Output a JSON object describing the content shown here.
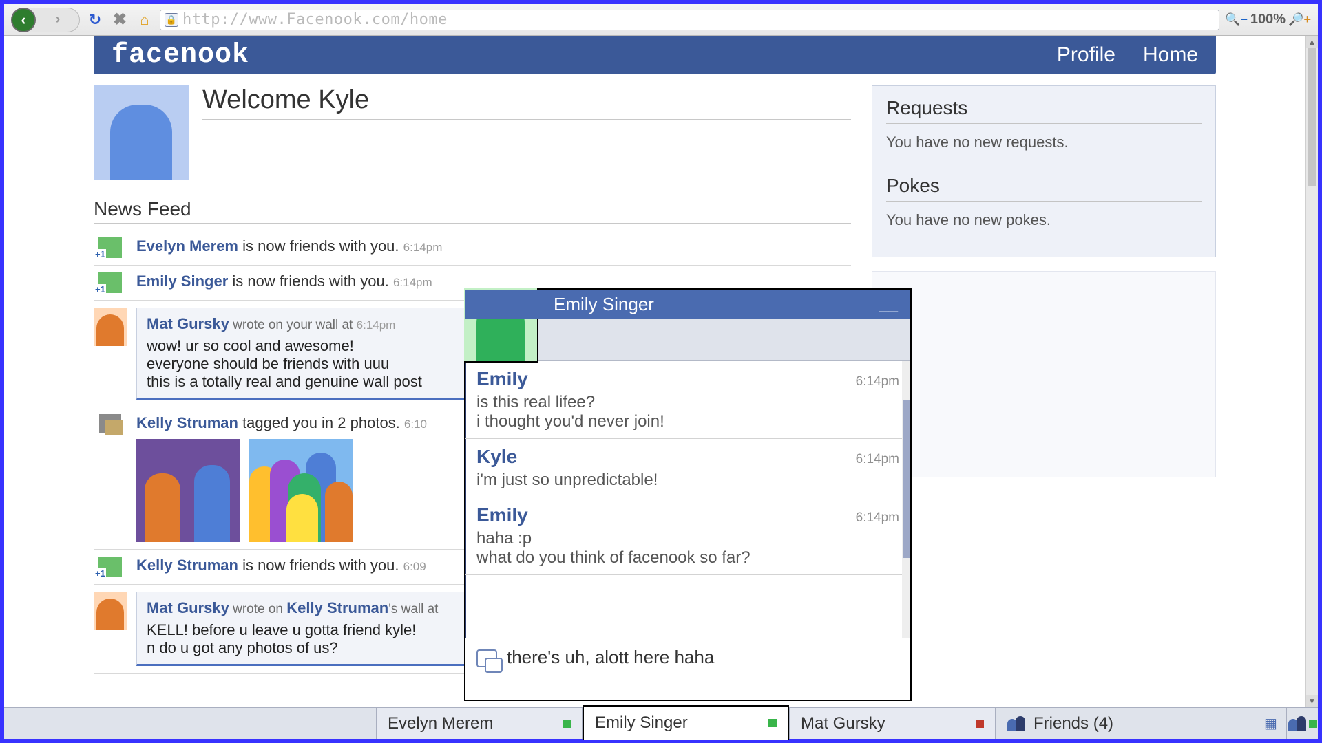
{
  "browser": {
    "url": "http://www.Facenook.com/home",
    "zoom": "100%"
  },
  "header": {
    "logo": "facenook",
    "links": {
      "profile": "Profile",
      "home": "Home"
    }
  },
  "welcome": {
    "title": "Welcome Kyle"
  },
  "sections": {
    "news_feed": "News Feed"
  },
  "feed": [
    {
      "actor": "Evelyn Merem",
      "verb": "is now friends with you.",
      "time": "6:14pm"
    },
    {
      "actor": "Emily Singer",
      "verb": "is now friends with you.",
      "time": "6:14pm"
    },
    {
      "actor_wall": "Mat Gursky",
      "wall_meta_prefix": "wrote on your wall at",
      "wall_time": "6:14pm",
      "wall_body": "wow! ur so cool and awesome!\neveryone should be friends with uuu\nthis is a totally real and genuine wall post"
    },
    {
      "actor": "Kelly Struman",
      "verb": "tagged you in 2 photos.",
      "time": "6:10"
    },
    {
      "actor": "Kelly Struman",
      "verb": "is now friends with you.",
      "time": "6:09"
    },
    {
      "actor_wall": "Mat Gursky",
      "wall_meta_prefix": "wrote on",
      "wall_target": "Kelly Struman",
      "wall_meta_suffix": "'s wall at",
      "wall_body": "KELL! before u leave u gotta friend kyle!\nn do u got any photos of us?"
    }
  ],
  "sidebar": {
    "requests": {
      "title": "Requests",
      "text": "You have no new requests."
    },
    "pokes": {
      "title": "Pokes",
      "text": "You have no new pokes."
    }
  },
  "chat": {
    "title": "Emily Singer",
    "messages": [
      {
        "from": "Emily",
        "time": "6:14pm",
        "text": "is this real lifee?\ni thought you'd never join!"
      },
      {
        "from": "Kyle",
        "time": "6:14pm",
        "text": "i'm just so unpredictable!"
      },
      {
        "from": "Emily",
        "time": "6:14pm",
        "text": "haha :p\nwhat do you think of facenook so far?"
      }
    ],
    "input_value": "there's uh, alott here haha"
  },
  "chatbar": {
    "tabs": [
      {
        "name": "Evelyn Merem",
        "status": "green"
      },
      {
        "name": "Emily Singer",
        "status": "green",
        "active": true
      },
      {
        "name": "Mat Gursky",
        "status": "red"
      }
    ],
    "friends_label": "Friends (4)"
  }
}
